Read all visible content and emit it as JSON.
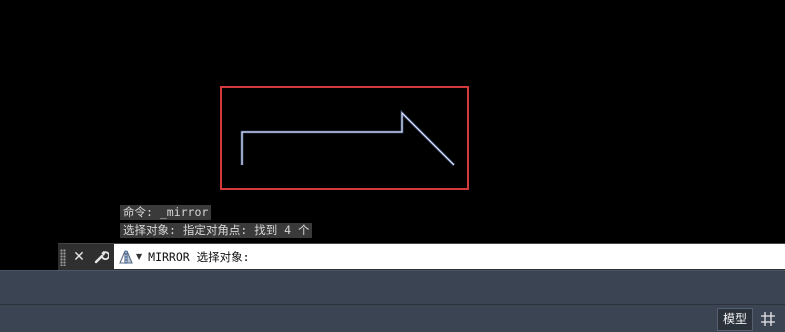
{
  "command_history": [
    "命令: _mirror",
    "选择对象: 指定对角点: 找到 4 个"
  ],
  "command_line": {
    "prompt": "MIRROR 选择对象:"
  },
  "status_bar": {
    "model_label": "模型"
  },
  "icons": {
    "close": "close-icon",
    "customize": "wrench-icon",
    "prompt": "mirror-command-icon",
    "grid": "grid-icon"
  },
  "colors": {
    "selection_window": "#d43a3a",
    "selected_geometry": "#8fb0ff",
    "canvas": "#000000"
  }
}
